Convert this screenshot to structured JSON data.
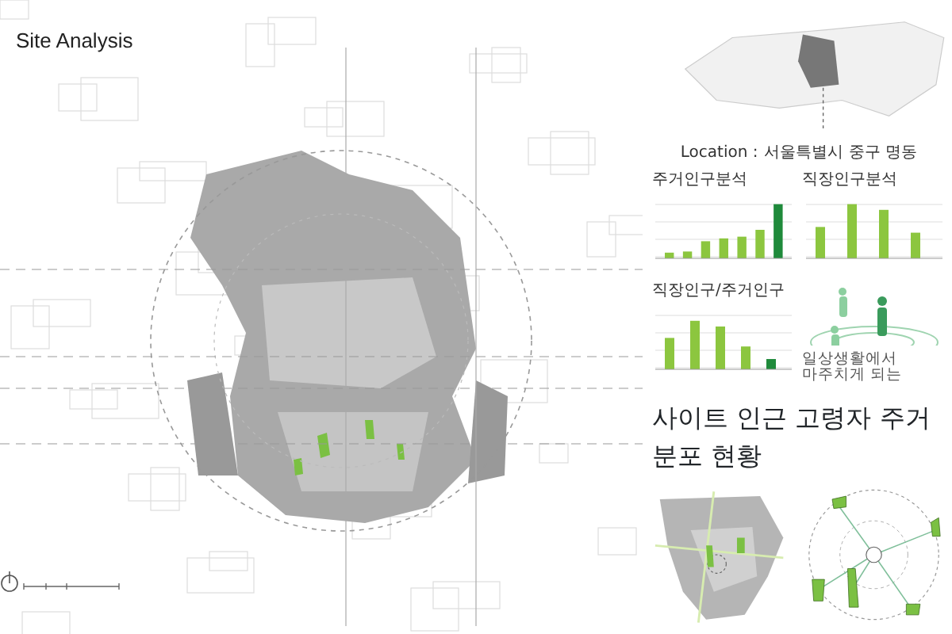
{
  "title": "Site Analysis",
  "location": {
    "label": "Location :",
    "value": "서울특별시 중구 명동"
  },
  "charts": [
    {
      "title": "주거인구분석"
    },
    {
      "title": "직장인구분석"
    },
    {
      "title": "직장인구/주거인구"
    }
  ],
  "illustration_caption": "일상생활에서 마주치게 되는",
  "distribution": {
    "title": "사이트 인근 고령자 주거 분포 현황"
  }
}
